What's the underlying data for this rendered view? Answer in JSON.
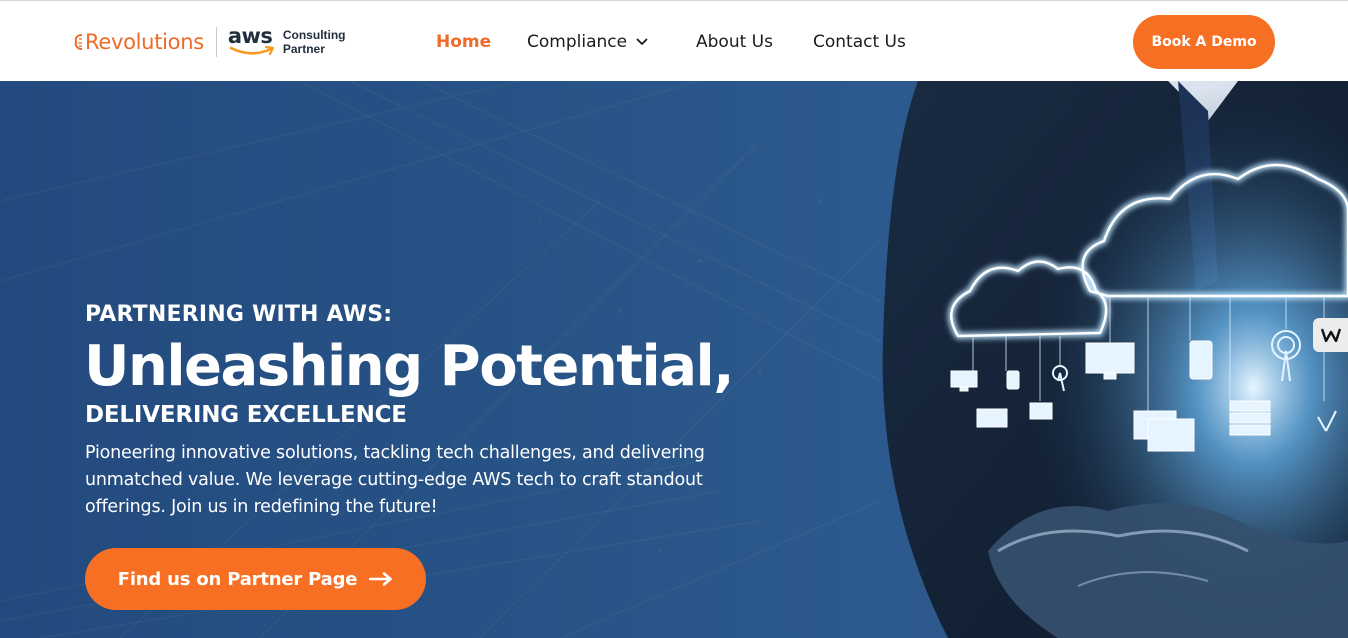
{
  "header": {
    "brand": "Revolutions",
    "aws_logo": {
      "word": "aws",
      "line1": "Consulting",
      "line2": "Partner"
    },
    "nav": [
      {
        "label": "Home",
        "active": true
      },
      {
        "label": "Compliance",
        "has_dropdown": true
      },
      {
        "label": "About Us"
      },
      {
        "label": "Contact Us"
      }
    ],
    "cta_label": "Book A Demo"
  },
  "hero": {
    "kicker": "PARTNERING WITH AWS:",
    "headline": "Unleashing Potential,",
    "subhead": "DELIVERING EXCELLENCE",
    "description": "Pioneering innovative solutions, tackling tech challenges, and delivering unmatched value. We leverage cutting-edge AWS tech to craft standout offerings. Join us in redefining the future!",
    "cta_label": "Find us on Partner Page",
    "image_icon": "hand-holding-cloud-network-image",
    "badge_icon": "w-logo-icon"
  },
  "colors": {
    "accent": "#f76f22",
    "brand_orange": "#f06a27",
    "hero_bg": "#285487",
    "aws_navy": "#232f3e"
  }
}
